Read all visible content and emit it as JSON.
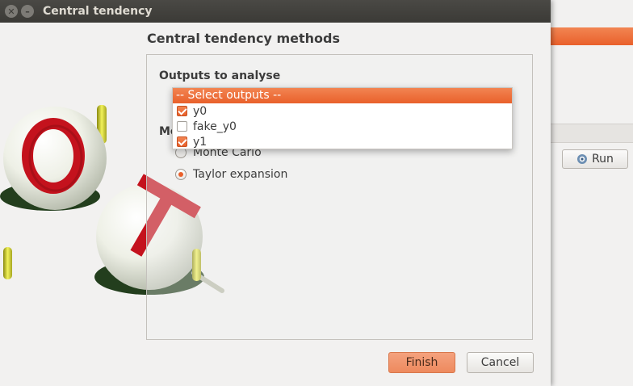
{
  "background_window": {
    "run_label": "Run",
    "run_icon": "gear-icon"
  },
  "dialog": {
    "title": "Central tendency",
    "close_icon": "close-icon",
    "minimize_icon": "minimize-icon",
    "page_heading": "Central tendency methods",
    "outputs_label": "Outputs to analyse",
    "methods_label": "Me",
    "outputs_dropdown": {
      "header": "-- Select outputs --",
      "items": [
        {
          "label": "y0",
          "checked": true
        },
        {
          "label": "fake_y0",
          "checked": false
        },
        {
          "label": "y1",
          "checked": true
        }
      ]
    },
    "methods": [
      {
        "label": "Monte Carlo",
        "selected": false
      },
      {
        "label": "Taylor expansion",
        "selected": true
      }
    ],
    "finish_label": "Finish",
    "cancel_label": "Cancel"
  },
  "colors": {
    "accent": "#e9602b",
    "titlebar": "#3b3a36",
    "background": "#f2f1f0"
  }
}
